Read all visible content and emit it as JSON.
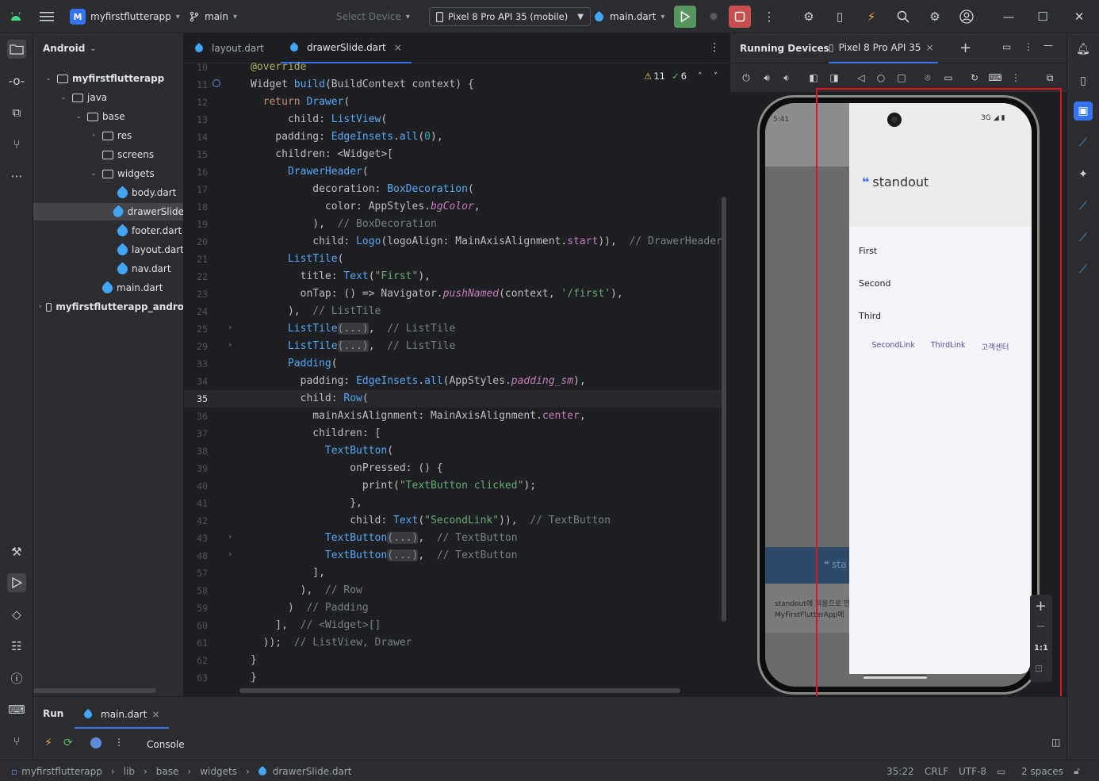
{
  "titlebar": {
    "project": "myfirstflutterapp",
    "project_badge": "M",
    "branch": "main",
    "select_device": "Select Device",
    "device": "Pixel 8 Pro API 35 (mobile)",
    "run_config": "main.dart"
  },
  "project_panel": {
    "header": "Android",
    "tree": [
      {
        "label": "myfirstflutterapp",
        "depth": 0,
        "type": "module",
        "twisty": "⌄"
      },
      {
        "label": "java",
        "depth": 1,
        "type": "folder",
        "twisty": "⌄"
      },
      {
        "label": "base",
        "depth": 2,
        "type": "folder",
        "twisty": "⌄"
      },
      {
        "label": "res",
        "depth": 3,
        "type": "folder",
        "twisty": "›"
      },
      {
        "label": "screens",
        "depth": 3,
        "type": "folder",
        "twisty": ""
      },
      {
        "label": "widgets",
        "depth": 3,
        "type": "folder",
        "twisty": "⌄"
      },
      {
        "label": "body.dart",
        "depth": 4,
        "type": "dart",
        "twisty": ""
      },
      {
        "label": "drawerSlide",
        "depth": 4,
        "type": "dart",
        "twisty": "",
        "selected": true
      },
      {
        "label": "footer.dart",
        "depth": 4,
        "type": "dart",
        "twisty": ""
      },
      {
        "label": "layout.dart",
        "depth": 4,
        "type": "dart",
        "twisty": ""
      },
      {
        "label": "nav.dart",
        "depth": 4,
        "type": "dart",
        "twisty": ""
      },
      {
        "label": "main.dart",
        "depth": 3,
        "type": "dart",
        "twisty": ""
      },
      {
        "label": "myfirstflutterapp_andro",
        "depth": 0,
        "type": "module",
        "twisty": "›"
      }
    ]
  },
  "editor": {
    "tabs": [
      {
        "label": "layout.dart",
        "active": false
      },
      {
        "label": "drawerSlide.dart",
        "active": true
      }
    ],
    "close_glyph": "×",
    "inspection": {
      "warnings": "11",
      "ok": "6"
    },
    "current_line": "35",
    "lines": [
      {
        "n": "10",
        "html": "<span class='ann'>@override</span>"
      },
      {
        "n": "11",
        "html": "Widget <span class='fn'>build</span>(BuildContext context) {"
      },
      {
        "n": "12",
        "html": "  <span class='kw'>return</span> <span class='cls'>Drawer</span>("
      },
      {
        "n": "13",
        "html": "      child: <span class='cls'>ListView</span>("
      },
      {
        "n": "14",
        "html": "    padding: <span class='cls'>EdgeInsets</span>.<span class='fn'>all</span>(<span class='num'>0</span>),"
      },
      {
        "n": "15",
        "html": "    children: &lt;Widget&gt;["
      },
      {
        "n": "16",
        "html": "      <span class='cls'>DrawerHeader</span>("
      },
      {
        "n": "17",
        "html": "          decoration: <span class='cls'>BoxDecoration</span>("
      },
      {
        "n": "18",
        "html": "            color: AppStyles.<span class='prop'>bgColor</span>,"
      },
      {
        "n": "19",
        "html": "          ),  <span class='cmt'>// BoxDecoration</span>"
      },
      {
        "n": "20",
        "html": "          child: <span class='cls'>Logo</span>(logoAlign: MainAxisAlignment.<span class='prop' style='font-style:normal'>start</span>)),  <span class='cmt'>// DrawerHeader</span>"
      },
      {
        "n": "21",
        "html": "      <span class='cls'>ListTile</span>("
      },
      {
        "n": "22",
        "html": "        title: <span class='cls'>Text</span>(<span class='str'>\"First\"</span>),"
      },
      {
        "n": "23",
        "html": "        onTap: () =&gt; Navigator.<span class='prop'>pushNamed</span>(context, <span class='str'>'/first'</span>),"
      },
      {
        "n": "24",
        "html": "      ),  <span class='cmt'>// ListTile</span>"
      },
      {
        "n": "25",
        "html": "      <span class='cls'>ListTile</span><span class='fold'>(...)</span>,  <span class='cmt'>// ListTile</span>"
      },
      {
        "n": "29",
        "html": "      <span class='cls'>ListTile</span><span class='fold'>(...)</span>,  <span class='cmt'>// ListTile</span>"
      },
      {
        "n": "33",
        "html": "      <span class='cls'>Padding</span>("
      },
      {
        "n": "34",
        "html": "        padding: <span class='cls'>EdgeInsets</span>.<span class='fn'>all</span>(AppStyles.<span class='prop'>padding_sm</span>),"
      },
      {
        "n": "35",
        "html": "        child: <span class='cls'>Row</span>("
      },
      {
        "n": "36",
        "html": "          mainAxisAlignment: MainAxisAlignment.<span class='prop' style='font-style:normal'>center</span>,"
      },
      {
        "n": "37",
        "html": "          children: ["
      },
      {
        "n": "38",
        "html": "            <span class='cls'>TextButton</span>("
      },
      {
        "n": "39",
        "html": "                onPressed: () {"
      },
      {
        "n": "40",
        "html": "                  <span class='fn' style='color:#bcbec4'>print</span>(<span class='str'>\"TextButton clicked\"</span>);"
      },
      {
        "n": "41",
        "html": "                },"
      },
      {
        "n": "42",
        "html": "                child: <span class='cls'>Text</span>(<span class='str'>\"SecondLink\"</span>)),  <span class='cmt'>// TextButton</span>"
      },
      {
        "n": "43",
        "html": "            <span class='cls'>TextButton</span><span class='fold'>(...)</span>,  <span class='cmt'>// TextButton</span>"
      },
      {
        "n": "48",
        "html": "            <span class='cls'>TextButton</span><span class='fold'>(...)</span>,  <span class='cmt'>// TextButton</span>"
      },
      {
        "n": "57",
        "html": "          ],"
      },
      {
        "n": "58",
        "html": "        ),  <span class='cmt'>// Row</span>"
      },
      {
        "n": "59",
        "html": "      )  <span class='cmt'>// Padding</span>"
      },
      {
        "n": "60",
        "html": "    ],  <span class='cmt'>// &lt;Widget&gt;[]</span>"
      },
      {
        "n": "61",
        "html": "  ));  <span class='cmt'>// ListView, Drawer</span>"
      },
      {
        "n": "62",
        "html": "}"
      },
      {
        "n": "63",
        "html": "}"
      }
    ]
  },
  "running_devices": {
    "title": "Running Devices",
    "tab": "Pixel 8 Pro API 35",
    "plus": "+",
    "zoom_in": "+",
    "zoom_out": "−",
    "zoom_reset": "1:1",
    "phone": {
      "time": "5:41",
      "network": "3G",
      "logo_mark": "❝",
      "logo_text": "standout",
      "menu": [
        "First",
        "Second",
        "Third"
      ],
      "links": [
        "SecondLink",
        "ThirdLink",
        "고객센터"
      ],
      "bg_logo": "❝ sta",
      "bg_text_1": "standout에 처음으로 만",
      "bg_text_2": "MyFirstFlutterApp에"
    }
  },
  "run_panel": {
    "tab_run": "Run",
    "tab_main": "main.dart",
    "console": "Console"
  },
  "statusbar": {
    "crumbs": [
      "myfirstflutterapp",
      "lib",
      "base",
      "widgets",
      "drawerSlide.dart"
    ],
    "position": "35:22",
    "line_sep": "CRLF",
    "encoding": "UTF-8",
    "indent": "2 spaces"
  },
  "colors": {
    "accent": "#3574f0",
    "highlight_box": "#e0141e",
    "run_green": "#57965c",
    "stop_red": "#c94f4f"
  }
}
